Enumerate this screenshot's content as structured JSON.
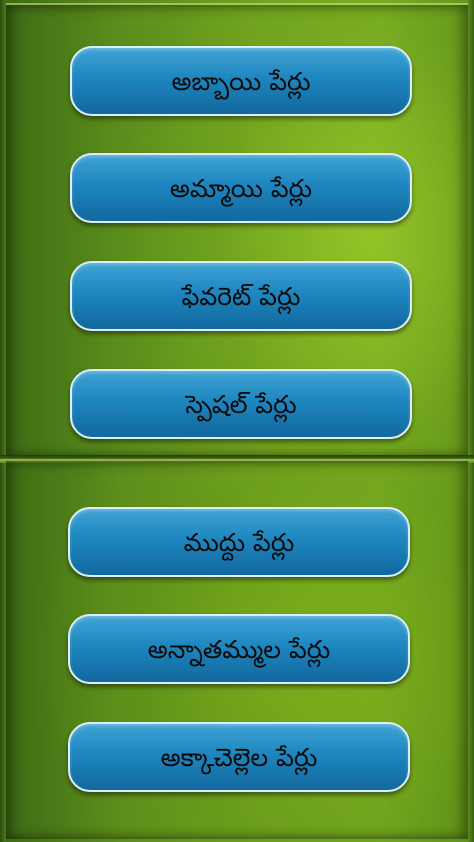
{
  "menu": {
    "items": [
      {
        "label": "అబ్బాయి పేర్లు"
      },
      {
        "label": "అమ్మాయి పేర్లు"
      },
      {
        "label": "ఫేవరెట్ పేర్లు"
      },
      {
        "label": "స్పెషల్ పేర్లు"
      },
      {
        "label": "ముద్దు పేర్లు"
      },
      {
        "label": "అన్నాతమ్ముల పేర్లు"
      },
      {
        "label": "అక్కాచెల్లెల పేర్లు"
      }
    ]
  },
  "colors": {
    "background_green": "#6fa21f",
    "button_blue": "#1e86c0",
    "button_border": "#d9eef8",
    "label_text": "#0b0b0b"
  }
}
